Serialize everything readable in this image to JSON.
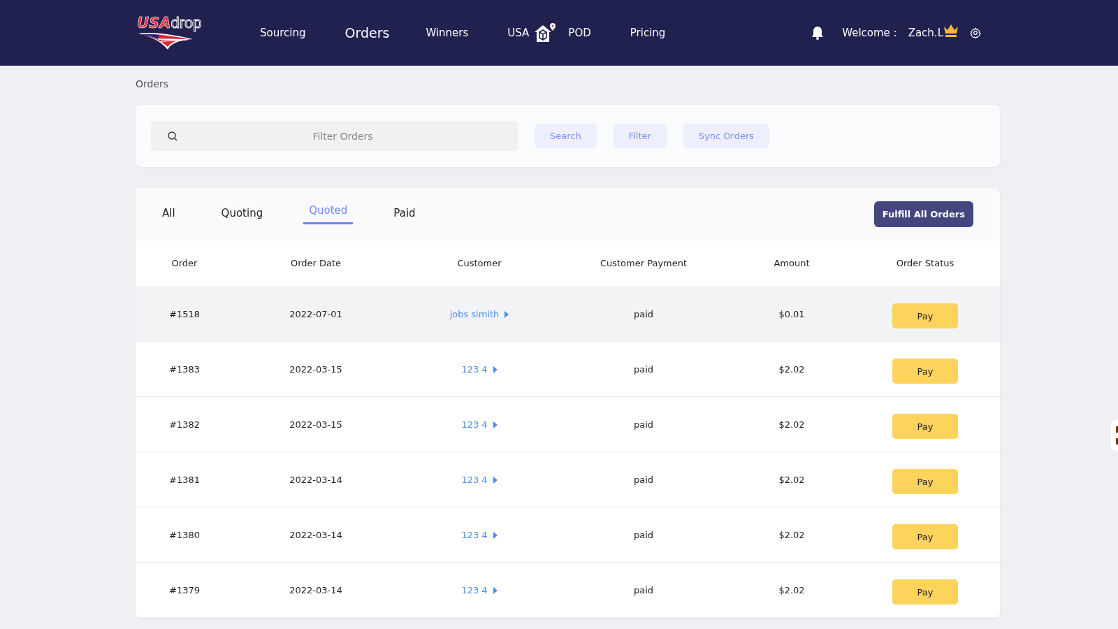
{
  "header": {
    "logo": {
      "first": "USA",
      "second": "drop"
    },
    "nav": [
      {
        "kind": "text",
        "label": "Sourcing",
        "selected": false
      },
      {
        "kind": "text",
        "label": "Orders",
        "selected": true
      },
      {
        "kind": "text",
        "label": "Winners",
        "selected": false
      },
      {
        "kind": "pod",
        "label": "USA",
        "label_end": "POD",
        "selected": false
      },
      {
        "kind": "text",
        "label": "Pricing",
        "selected": false
      }
    ],
    "welcome": "Welcome :",
    "user": "Zach.L"
  },
  "breadcrumb": "Orders",
  "search": {
    "placeholder": "Filter Orders",
    "buttons": [
      "Search",
      "Filter",
      "Sync Orders"
    ]
  },
  "tabs": [
    {
      "label": "All",
      "selected": false
    },
    {
      "label": "Quoting",
      "selected": false
    },
    {
      "label": "Quoted",
      "selected": true
    },
    {
      "label": "Paid",
      "selected": false
    }
  ],
  "fulfill_button": "Fulfill All Orders",
  "table": {
    "columns": [
      "Order",
      "Order Date",
      "Customer",
      "Customer Payment",
      "Amount",
      "Order Status"
    ],
    "rows": [
      {
        "order": "#1518",
        "date": "2022-07-01",
        "customer": "jobs simith",
        "payment": "paid",
        "amount": "$0.01",
        "action": "Pay",
        "highlighted": true
      },
      {
        "order": "#1383",
        "date": "2022-03-15",
        "customer": "123 4",
        "payment": "paid",
        "amount": "$2.02",
        "action": "Pay",
        "highlighted": false
      },
      {
        "order": "#1382",
        "date": "2022-03-15",
        "customer": "123 4",
        "payment": "paid",
        "amount": "$2.02",
        "action": "Pay",
        "highlighted": false
      },
      {
        "order": "#1381",
        "date": "2022-03-14",
        "customer": "123 4",
        "payment": "paid",
        "amount": "$2.02",
        "action": "Pay",
        "highlighted": false
      },
      {
        "order": "#1380",
        "date": "2022-03-14",
        "customer": "123 4",
        "payment": "paid",
        "amount": "$2.02",
        "action": "Pay",
        "highlighted": false
      },
      {
        "order": "#1379",
        "date": "2022-03-14",
        "customer": "123 4",
        "payment": "paid",
        "amount": "$2.02",
        "action": "Pay",
        "highlighted": false
      }
    ]
  }
}
